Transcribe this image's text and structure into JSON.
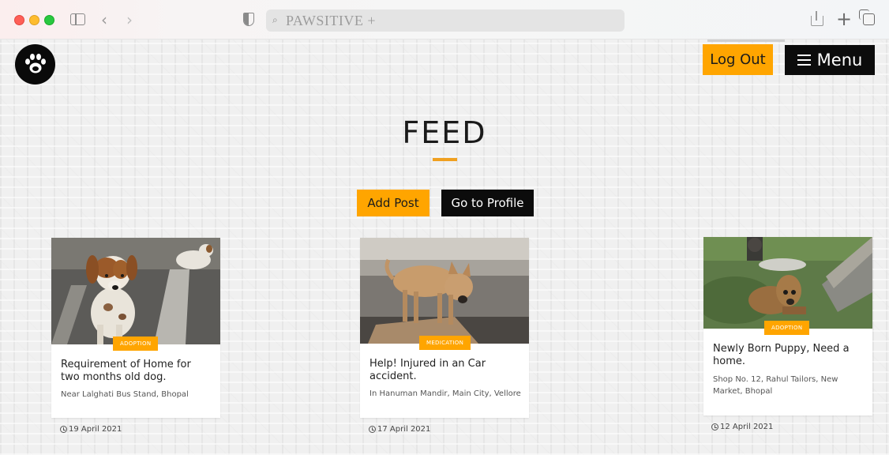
{
  "browser": {
    "address": "PAWSITIVE +"
  },
  "header": {
    "logout_label": "Log Out",
    "menu_label": "Menu"
  },
  "feed": {
    "title": "FEED",
    "add_post_label": "Add Post",
    "profile_label": "Go to Profile"
  },
  "posts": [
    {
      "badge": "ADOPTION",
      "title": "Requirement of Home for two months old dog.",
      "location": "Near Lalghati Bus Stand, Bhopal",
      "date": "19 April 2021"
    },
    {
      "badge": "MEDICATION",
      "title": "Help! Injured in an Car accident.",
      "location": "In Hanuman Mandir, Main City, Vellore",
      "date": "17 April 2021"
    },
    {
      "badge": "ADOPTION",
      "title": "Newly Born Puppy, Need a home.",
      "location": "Shop No. 12, Rahul Tailors, New Market, Bhopal",
      "date": "12 April 2021"
    }
  ],
  "colors": {
    "accent": "#ffa500",
    "dark": "#0c0c0c"
  },
  "icons": {
    "logo": "paw-icon",
    "menu": "hamburger-icon",
    "date": "clock-icon"
  }
}
